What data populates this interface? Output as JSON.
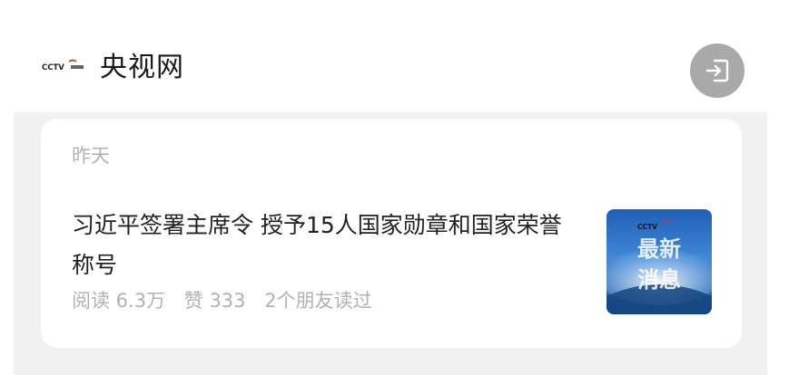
{
  "header": {
    "logo_text": "CCTV",
    "source_name": "央视网",
    "exit_icon": "exit-icon"
  },
  "article": {
    "date": "昨天",
    "headline": "习近平签署主席令 授予15人国家勋章和国家荣誉称号",
    "meta": {
      "reads": "阅读 6.3万",
      "likes": "赞 333",
      "friends_read": "2个朋友读过"
    },
    "thumbnail": {
      "logo_text": "CCTV",
      "line1": "最新",
      "line2": "消息"
    }
  },
  "colors": {
    "background": "#f0f1f0",
    "card": "#ffffff",
    "button_gray": "#a9a9a9",
    "muted_text": "#b2b2b2",
    "thumb_blue": "#2e6cc0"
  }
}
